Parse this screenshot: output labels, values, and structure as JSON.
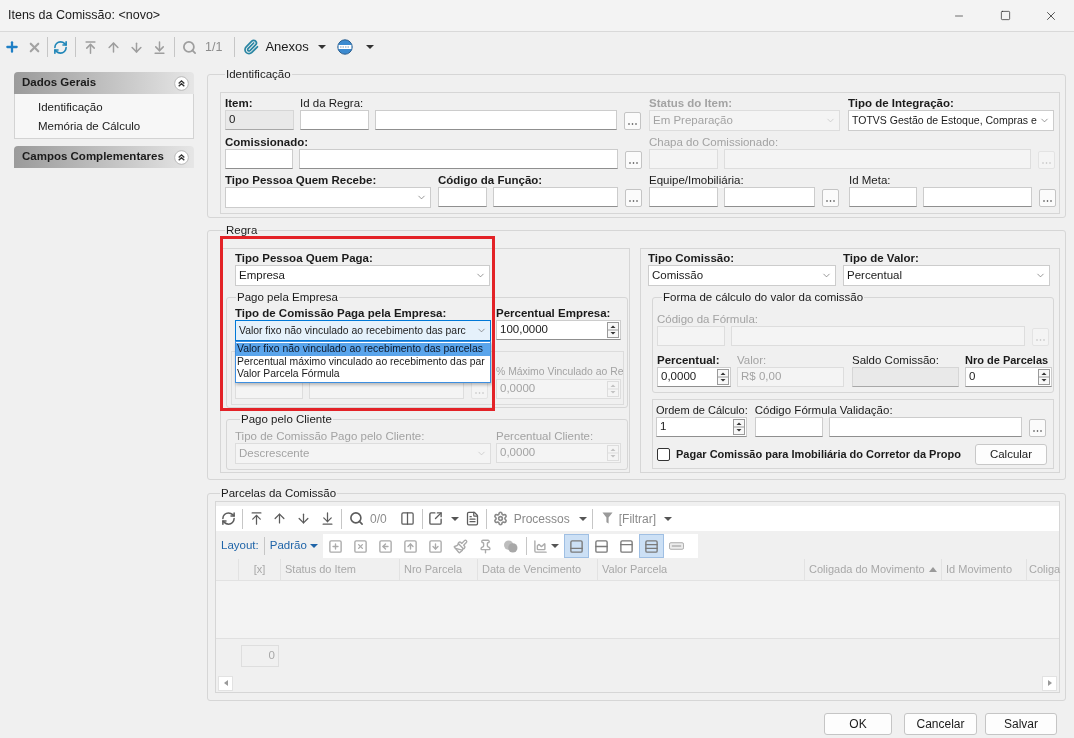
{
  "window": {
    "title": "Itens da Comissão: <novo>"
  },
  "toolbar": {
    "record_counter": "1/1",
    "attachments_label": "Anexos"
  },
  "sidebar": {
    "sections": [
      {
        "title": "Dados Gerais",
        "expanded": true,
        "items": [
          "Identificação",
          "Memória de Cálculo"
        ]
      },
      {
        "title": "Campos Complementares",
        "expanded": true
      }
    ]
  },
  "identificacao": {
    "title": "Identificação",
    "fields": [
      {
        "label": "Item:",
        "kind": "display",
        "required": true,
        "disabled": false,
        "value": "0"
      },
      {
        "label": "Id da Regra:",
        "kind": "lookup",
        "required": false,
        "disabled": false
      },
      {
        "label": "Status do Item:",
        "kind": "select",
        "required": true,
        "disabled": true,
        "value": "Em Preparação"
      },
      {
        "label": "Tipo de Integração:",
        "kind": "select",
        "required": true,
        "disabled": false,
        "value": "TOTVS Gestão de Estoque, Compras e"
      },
      {
        "label": "Comissionado:",
        "kind": "lookup",
        "required": true,
        "disabled": false
      },
      {
        "label": "Chapa do Comissionado:",
        "kind": "lookup",
        "required": false,
        "disabled": true
      },
      {
        "label": "Tipo Pessoa Quem Recebe:",
        "kind": "select",
        "required": true,
        "disabled": false
      },
      {
        "label": "Código da Função:",
        "kind": "lookup",
        "required": true,
        "disabled": false
      },
      {
        "label": "Equipe/Imobiliária:",
        "kind": "lookup",
        "required": false,
        "disabled": false
      },
      {
        "label": "Id Meta:",
        "kind": "lookup",
        "required": false,
        "disabled": false
      }
    ]
  },
  "regra": {
    "title": "Regra",
    "tipo_pessoa_quem_paga": {
      "label": "Tipo Pessoa Quem Paga:",
      "kind": "select",
      "required": true,
      "disabled": false,
      "value": "Empresa"
    },
    "pago_pela_empresa": {
      "title": "Pago pela Empresa",
      "fields": [
        {
          "label": "Tipo de Comissão Paga pela Empresa:",
          "kind": "select",
          "required": true,
          "disabled": false,
          "value": "Valor fixo não vinculado ao recebimento das parc",
          "expanded": true,
          "options": [
            {
              "label": "Valor fixo não vinculado ao recebimento das parcelas",
              "selected": true
            },
            {
              "label": "Percentual máximo vinculado ao recebimento das par",
              "selected": false
            },
            {
              "label": "Valor Parcela Fórmula",
              "selected": false
            }
          ]
        },
        {
          "label": "Percentual Empresa:",
          "kind": "spin",
          "required": true,
          "disabled": false,
          "value": "100,0000"
        },
        {
          "kind": "lookup",
          "disabled": true
        },
        {
          "label": "% Máximo Vinculado ao Re",
          "kind": "spin",
          "required": false,
          "disabled": true,
          "value": "0,0000"
        }
      ]
    },
    "pago_pelo_cliente": {
      "title": "Pago pelo Cliente",
      "fields": [
        {
          "label": "Tipo de Comissão Pago pelo Cliente:",
          "kind": "select",
          "required": false,
          "disabled": true,
          "value": "Descrescente"
        },
        {
          "label": "Percentual Cliente:",
          "kind": "spin",
          "required": false,
          "disabled": true,
          "value": "0,0000"
        }
      ]
    },
    "tipo_comissao": {
      "label": "Tipo Comissão:",
      "kind": "select",
      "required": true,
      "disabled": false,
      "value": "Comissão"
    },
    "tipo_de_valor": {
      "label": "Tipo de Valor:",
      "kind": "select",
      "required": true,
      "disabled": false,
      "value": "Percentual"
    },
    "forma_de_calculo": {
      "title": "Forma de cálculo do valor da comissão",
      "fields": [
        {
          "label": "Código da Fórmula:",
          "kind": "lookup",
          "required": false,
          "disabled": true
        },
        {
          "label": "Percentual:",
          "kind": "spin",
          "required": true,
          "disabled": false,
          "value": "0,0000"
        },
        {
          "label": "Valor:",
          "kind": "display",
          "required": false,
          "disabled": true,
          "value": "R$ 0,00"
        },
        {
          "label": "Saldo Comissão:",
          "kind": "display",
          "required": false,
          "disabled": false
        },
        {
          "label": "Nro de Parcelas",
          "kind": "spin",
          "required": true,
          "disabled": false,
          "value": "0"
        }
      ]
    },
    "ordem_de_calculo": {
      "label": "Ordem de Cálculo:",
      "kind": "spin",
      "required": false,
      "disabled": false,
      "value": "1"
    },
    "codigo_formula_validacao": {
      "label": "Código Fórmula Validação:",
      "kind": "lookup",
      "required": false,
      "disabled": false
    },
    "pagar_comissao_imobiliaria": {
      "label": "Pagar Comissão para Imobiliária do Corretor da Propo",
      "checked": false
    },
    "calcular_button": "Calcular"
  },
  "parcelas": {
    "title": "Parcelas da Comissão",
    "record_counter": "0/0",
    "processes_label": "Processos",
    "filter_label": "[Filtrar]",
    "layout_label": "Layout:",
    "layout_value": "Padrão",
    "view_toggles": [
      {
        "kind": "footer",
        "selected": true
      },
      {
        "kind": "rows",
        "selected": false
      },
      {
        "kind": "header",
        "selected": false
      },
      {
        "kind": "band",
        "selected": true
      }
    ],
    "columns": [
      {
        "label": "[x]",
        "sorted": false
      },
      {
        "label": "Status do Item",
        "sorted": false
      },
      {
        "label": "Nro Parcela",
        "sorted": false
      },
      {
        "label": "Data de Vencimento",
        "sorted": false
      },
      {
        "label": "Valor Parcela",
        "sorted": false
      },
      {
        "label": "Coligada do Movimento",
        "sorted": true
      },
      {
        "label": "Id Movimento",
        "sorted": false
      },
      {
        "label": "Coliga"
      }
    ],
    "summary_value": "0"
  },
  "buttons": [
    "OK",
    "Cancelar",
    "Salvar"
  ]
}
